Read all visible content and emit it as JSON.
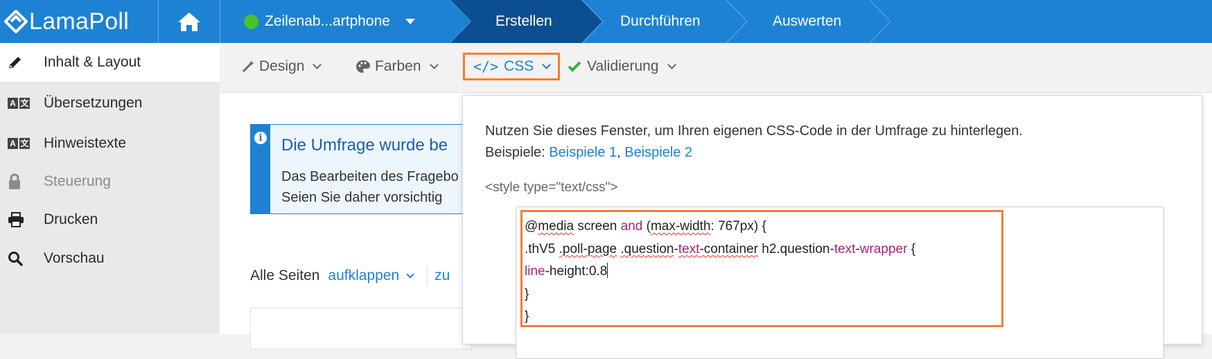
{
  "app": {
    "logo_text": "LamaPoll",
    "brand_color": "#1d82d3",
    "accent_highlight": "#f08030"
  },
  "topbar": {
    "home_icon": "home-icon",
    "survey_selector": {
      "label": "Zeilenab...artphone",
      "status_color": "#4cc02a"
    },
    "steps": [
      {
        "label": "Erstellen",
        "active": true
      },
      {
        "label": "Durchführen",
        "active": false
      },
      {
        "label": "Auswerten",
        "active": false
      }
    ]
  },
  "sidebar": {
    "items": [
      {
        "label": "Inhalt & Layout",
        "icon": "pencil-icon",
        "active": true
      },
      {
        "label": "Übersetzungen",
        "icon": "translate-icon"
      },
      {
        "label": "Hinweistexte",
        "icon": "translate-icon"
      },
      {
        "label": "Steuerung",
        "icon": "lock-icon",
        "disabled": true
      },
      {
        "label": "Drucken",
        "icon": "printer-icon"
      },
      {
        "label": "Vorschau",
        "icon": "search-icon"
      }
    ]
  },
  "toolbar": {
    "design": "Design",
    "farben": "Farben",
    "css": "CSS",
    "validierung": "Validierung"
  },
  "main": {
    "info_title": "Die Umfrage wurde be",
    "info_line1": "Das Bearbeiten des Fragebo",
    "info_line2": "Seien Sie daher vorsichtig",
    "pages_label": "Alle Seiten",
    "expand_label": "aufklappen",
    "collapse_label": "zu"
  },
  "css_panel": {
    "desc_line1": "Nutzen Sie dieses Fenster, um Ihren eigenen CSS-Code in der Umfrage zu hinterlegen.",
    "examples_prefix": "Beispiele: ",
    "example1": "Beispiele 1",
    "example_sep": ", ",
    "example2": "Beispiele 2",
    "style_tag": "<style type=\"text/css\">",
    "code_lines": [
      "@media screen and (max-width: 767px) {",
      ".thV5 .poll-page .question-text-container h2.question-text-wrapper {",
      "line-height:0.8",
      "}",
      "}"
    ]
  }
}
